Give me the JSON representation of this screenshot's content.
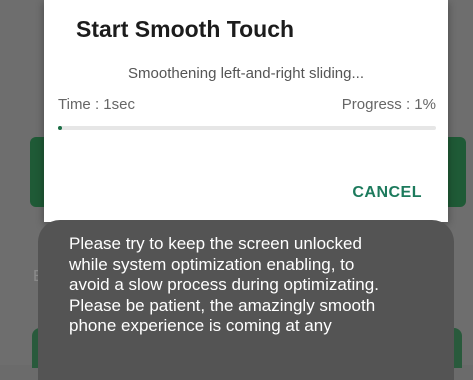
{
  "dialog": {
    "title": "Start Smooth Touch",
    "message": "Smoothening left-and-right sliding...",
    "time_label": "Time : 1sec",
    "progress_label": "Progress : 1%",
    "progress_value": 0.01,
    "cancel_label": "CANCEL"
  },
  "background": {
    "partial_letter": "E"
  },
  "toast": {
    "message": "Please try to keep the screen unlocked\nwhile system optimization enabling, to\navoid a slow process during optimizating.\nPlease be patient, the amazingly smooth\nphone experience is coming at any"
  },
  "colors": {
    "accent": "#1b6e45",
    "cancel": "#1c7a5c",
    "scrim": "#6e6e6e",
    "toast_bg": "#545454",
    "background_card": "#1f5a36"
  }
}
